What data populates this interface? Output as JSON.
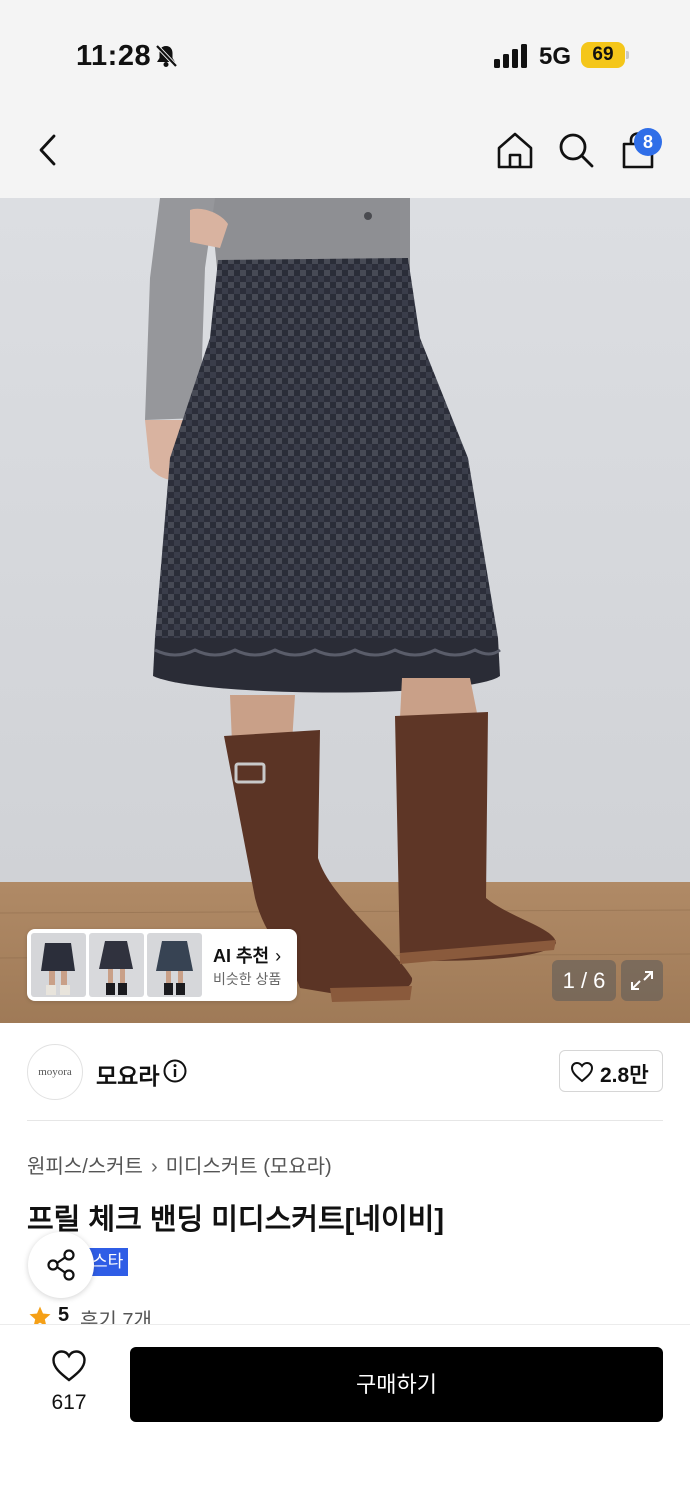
{
  "status_bar": {
    "time": "11:28",
    "network": "5G",
    "battery": "69",
    "icons": [
      "bell-slash-icon",
      "signal-icon",
      "battery-icon"
    ]
  },
  "nav": {
    "cart_count": "8",
    "icons": [
      "back-chevron-icon",
      "home-icon",
      "search-icon",
      "shopping-bag-icon"
    ]
  },
  "gallery": {
    "ai_recommend": {
      "title": "AI 추천",
      "subtitle": "비슷한 상품"
    },
    "page_counter": "1 / 6"
  },
  "brand": {
    "logo_text": "moyora",
    "name": "모요라",
    "like_count": "2.8만"
  },
  "product": {
    "breadcrumb": [
      "원피스/스커트",
      "미디스커트 (모요라)"
    ],
    "title": "프릴 체크 밴딩 미디스커트[네이비]",
    "badge_text": "스타",
    "rating": "5",
    "review_count": "후기 7개"
  },
  "bottom_bar": {
    "wish_count": "617",
    "buy_label": "구매하기"
  },
  "colors": {
    "badge_blue": "#2f6ee8",
    "tag_blue": "#2f5de6",
    "battery_yellow": "#f4c61a",
    "star_orange": "#f5a017",
    "buy_button": "#000000"
  }
}
